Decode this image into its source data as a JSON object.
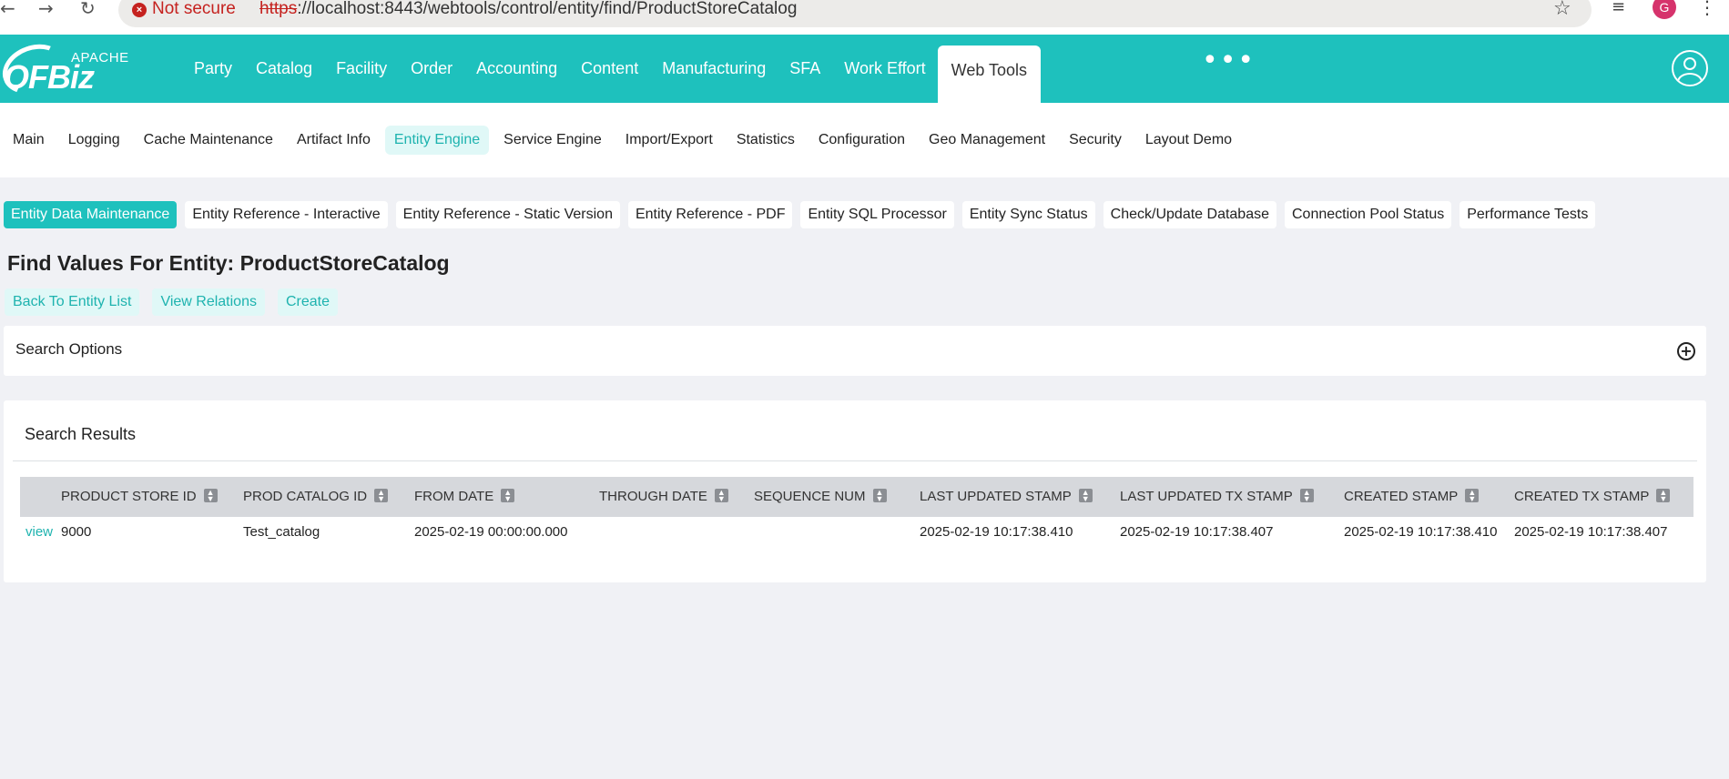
{
  "browser": {
    "not_secure": "Not secure",
    "url_scheme": "https",
    "url_rest": "://localhost:8443/webtools/control/entity/find/ProductStoreCatalog",
    "profile_initial": "G"
  },
  "logo": {
    "apache": "APACHE",
    "name": "OFBiz"
  },
  "apps": [
    "Party",
    "Catalog",
    "Facility",
    "Order",
    "Accounting",
    "Content",
    "Manufacturing",
    "SFA",
    "Work Effort",
    "Web Tools"
  ],
  "active_app": "Web Tools",
  "submenu": [
    "Main",
    "Logging",
    "Cache Maintenance",
    "Artifact Info",
    "Entity Engine",
    "Service Engine",
    "Import/Export",
    "Statistics",
    "Configuration",
    "Geo Management",
    "Security",
    "Layout Demo"
  ],
  "tabs": [
    "Entity Data Maintenance",
    "Entity Reference - Interactive",
    "Entity Reference - Static Version",
    "Entity Reference - PDF",
    "Entity SQL Processor",
    "Entity Sync Status",
    "Check/Update Database",
    "Connection Pool Status",
    "Performance Tests"
  ],
  "page_title": "Find Values For Entity: ProductStoreCatalog",
  "actions": [
    "Back To Entity List",
    "View Relations",
    "Create"
  ],
  "search_options": {
    "label": "Search Options"
  },
  "results": {
    "title": "Search Results",
    "columns": [
      "PRODUCT STORE ID",
      "PROD CATALOG ID",
      "FROM DATE",
      "THROUGH DATE",
      "SEQUENCE NUM",
      "LAST UPDATED STAMP",
      "LAST UPDATED TX STAMP",
      "CREATED STAMP",
      "CREATED TX STAMP"
    ],
    "rows": [
      [
        "view",
        "9000",
        "Test_catalog",
        "2025-02-19 00:00:00.000",
        "",
        "",
        "2025-02-19 10:17:38.410",
        "2025-02-19 10:17:38.407",
        "2025-02-19 10:17:38.410",
        "2025-02-19 10:17:38.407"
      ]
    ]
  }
}
